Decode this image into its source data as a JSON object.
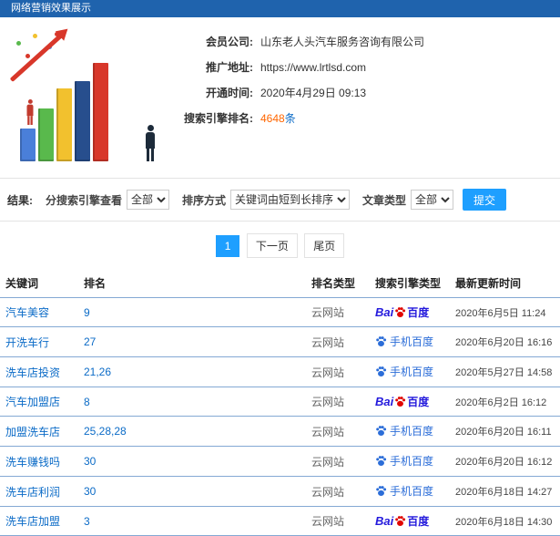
{
  "header": {
    "title": "网络营销效果展示"
  },
  "info": {
    "member_label": "会员公司:",
    "member_value": "山东老人头汽车服务咨询有限公司",
    "url_label": "推广地址:",
    "url_value": "https://www.lrtlsd.com",
    "open_label": "开通时间:",
    "open_value": "2020年4月29日 09:13",
    "rank_label": "搜索引擎排名:",
    "rank_count": "4648",
    "rank_unit": "条"
  },
  "filters": {
    "result_label": "结果:",
    "engine_label": "分搜索引擎查看",
    "engine_value": "全部",
    "sort_label": "排序方式",
    "sort_value": "关键词由短到长排序",
    "type_label": "文章类型",
    "type_value": "全部",
    "submit_label": "提交"
  },
  "pagination": {
    "current": "1",
    "next": "下一页",
    "last": "尾页"
  },
  "logos": {
    "baidu_prefix": "Bai",
    "baidu_suffix": "百度",
    "mobile_label": "手机百度"
  },
  "table": {
    "headers": [
      "关键词",
      "排名",
      "排名类型",
      "搜索引擎类型",
      "最新更新时间"
    ],
    "rows": [
      {
        "keyword": "汽车美容",
        "rank": "9",
        "rank_type": "云网站",
        "engine": "baidu",
        "updated": "2020年6月5日 11:24"
      },
      {
        "keyword": "开洗车行",
        "rank": "27",
        "rank_type": "云网站",
        "engine": "mobile",
        "updated": "2020年6月20日 16:16"
      },
      {
        "keyword": "洗车店投资",
        "rank": "21,26",
        "rank_type": "云网站",
        "engine": "mobile",
        "updated": "2020年5月27日 14:58"
      },
      {
        "keyword": "汽车加盟店",
        "rank": "8",
        "rank_type": "云网站",
        "engine": "baidu",
        "updated": "2020年6月2日 16:12"
      },
      {
        "keyword": "加盟洗车店",
        "rank": "25,28,28",
        "rank_type": "云网站",
        "engine": "mobile",
        "updated": "2020年6月20日 16:11"
      },
      {
        "keyword": "洗车赚钱吗",
        "rank": "30",
        "rank_type": "云网站",
        "engine": "mobile",
        "updated": "2020年6月20日 16:12"
      },
      {
        "keyword": "洗车店利润",
        "rank": "30",
        "rank_type": "云网站",
        "engine": "mobile",
        "updated": "2020年6月18日 14:27"
      },
      {
        "keyword": "洗车店加盟",
        "rank": "3",
        "rank_type": "云网站",
        "engine": "baidu",
        "updated": "2020年6月18日 14:30"
      }
    ]
  },
  "illustration": {
    "bar_colors": [
      "#4a7fd9",
      "#59b94c",
      "#f2c12e",
      "#274e8d",
      "#d8372a"
    ],
    "bar_heights": [
      36,
      58,
      80,
      88,
      108
    ]
  },
  "colors": {
    "header_bg": "#1f63ad",
    "link": "#0b6bc7",
    "highlight": "#ff6600",
    "accent": "#1e9fff",
    "baidu_red": "#e10601",
    "baidu_blue": "#2319dc",
    "mobile_blue": "#2b6dd8",
    "row_border": "#84a9d4"
  }
}
